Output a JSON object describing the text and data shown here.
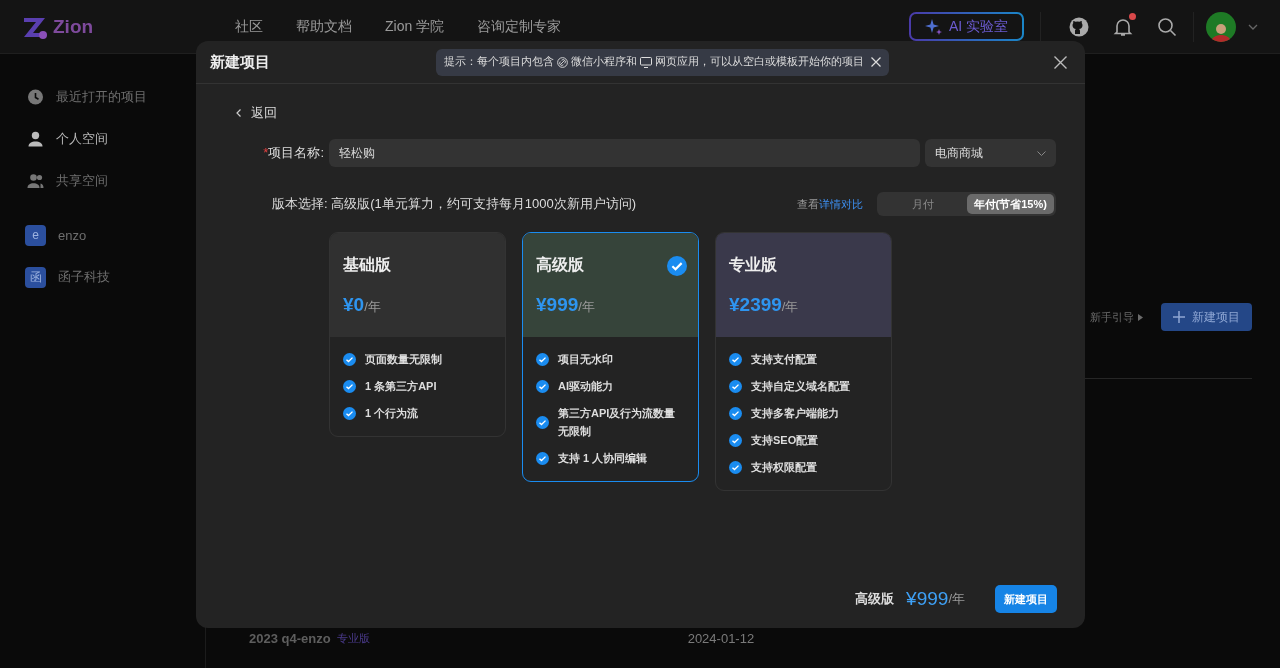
{
  "topbar": {
    "logo": "Zion",
    "nav": [
      "社区",
      "帮助文档",
      "Zion 学院",
      "咨询定制专家"
    ],
    "ai_button": "AI 实验室",
    "has_notification": true
  },
  "sidebar": {
    "items": [
      {
        "kind": "clock",
        "label": "最近打开的项目",
        "selected": false
      },
      {
        "kind": "person",
        "label": "个人空间",
        "selected": true
      },
      {
        "kind": "people",
        "label": "共享空间",
        "selected": false
      }
    ],
    "teams": [
      {
        "initial": "e",
        "name": "enzo"
      },
      {
        "initial": "函",
        "name": "函子科技"
      }
    ]
  },
  "main": {
    "guide_link": "新手引导",
    "new_button": "新建项目",
    "rows": [
      {
        "name": "2023 q4-enzo",
        "tag": "专业版",
        "date": "2024-01-12"
      }
    ]
  },
  "modal": {
    "title": "新建项目",
    "tip": {
      "prefix": "提示：每个项目内包含",
      "wechat": "微信小程序和",
      "web": "网页应用，可以从空白或模板开始你的项目"
    },
    "back": "返回",
    "name_label": "项目名称:",
    "required_mark": "*",
    "name_value": "轻松购",
    "category": "电商商城",
    "version_label": "版本选择:",
    "version_desc": "高级版(1单元算力，约可支持每月1000次新用户访问)",
    "compare_prefix": "查看",
    "compare_link": "详情对比",
    "billing": [
      {
        "label": "月付",
        "selected": false
      },
      {
        "label": "年付(节省15%)",
        "selected": true
      }
    ],
    "plans": [
      {
        "name": "基础版",
        "price": "¥0",
        "unit": "/年",
        "color": "#303030",
        "selected": false,
        "features": [
          "页面数量无限制",
          "1 条第三方API",
          "1 个行为流"
        ]
      },
      {
        "name": "高级版",
        "price": "¥999",
        "unit": "/年",
        "color": "#36443a",
        "selected": true,
        "features": [
          "项目无水印",
          "AI驱动能力",
          "第三方API及行为流数量无限制",
          "支持 1 人协同编辑"
        ]
      },
      {
        "name": "专业版",
        "price": "¥2399",
        "unit": "/年",
        "color": "#3a394b",
        "selected": false,
        "features": [
          "支持支付配置",
          "支持自定义域名配置",
          "支持多客户端能力",
          "支持SEO配置",
          "支持权限配置"
        ]
      }
    ],
    "footer": {
      "plan": "高级版",
      "price": "¥999",
      "unit": "/年",
      "button": "新建项目"
    }
  }
}
